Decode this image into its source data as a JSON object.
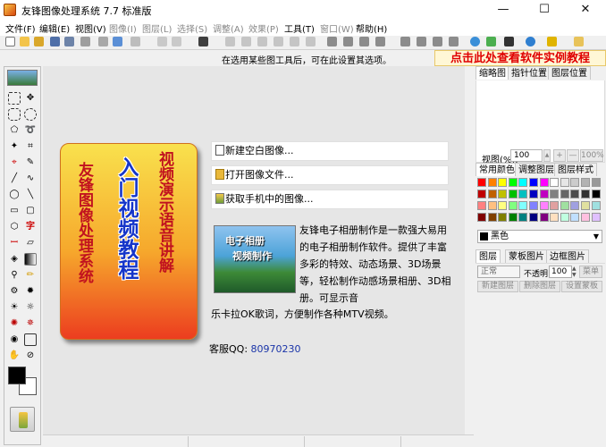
{
  "window": {
    "title": "友锋图像处理系统 7.7 标准版",
    "min": "—",
    "max": "☐",
    "close": "✕"
  },
  "menu": [
    {
      "label": "文件(F)",
      "enabled": true
    },
    {
      "label": "编辑(E)",
      "enabled": true
    },
    {
      "label": "视图(V)",
      "enabled": true
    },
    {
      "label": "图像(I)",
      "enabled": false
    },
    {
      "label": "图层(L)",
      "enabled": false
    },
    {
      "label": "选择(S)",
      "enabled": false
    },
    {
      "label": "调整(A)",
      "enabled": false
    },
    {
      "label": "效果(P)",
      "enabled": false
    },
    {
      "label": "工具(T)",
      "enabled": true
    },
    {
      "label": "窗口(W)",
      "enabled": false
    },
    {
      "label": "帮助(H)",
      "enabled": true
    }
  ],
  "hint": "在选用某些图工具后，可在此设置其选项。",
  "promo": "点击此处查看软件实例教程",
  "colors": {
    "accent_red": "#e00000",
    "link_blue": "#1a34a8"
  },
  "welcome": {
    "card": {
      "col1": "友锋图像处理系统",
      "col2": "入门视频教程",
      "col3": "视频演示语音讲解"
    },
    "actions": [
      {
        "label": "新建空白图像...",
        "icon": "new-doc-icon"
      },
      {
        "label": "打开图像文件...",
        "icon": "open-folder-icon"
      },
      {
        "label": "获取手机中的图像...",
        "icon": "phone-icon"
      }
    ],
    "image_overlay": {
      "line1": "电子相册",
      "line2": "视频制作"
    },
    "description_a": "友锋电子相册制作是一款强大易用的电子相册制作软件。提供了丰富多彩的特效、动态场景、3D场景等，轻松制作动感场景相册、3D相册。可显示音",
    "description_b": "乐卡拉OK歌词，方便制作各种MTV视频。",
    "qq_label": "客服QQ:",
    "qq_number": "80970230"
  },
  "right_panel": {
    "nav_tabs": [
      "缩略图",
      "指针位置",
      "图层位置"
    ],
    "zoom_label": "视图(%):",
    "zoom_value": "100",
    "zoom_plus": "+",
    "zoom_minus": "—",
    "zoom_full": "100%",
    "color_tabs": [
      "常用颜色",
      "调整图层",
      "图层样式"
    ],
    "selected_color": "黑色",
    "layer_tabs": [
      "图层",
      "蒙板图片",
      "边框图片"
    ],
    "blend_mode": "正常",
    "opacity_label": "不透明",
    "opacity_value": "100",
    "menu_btn": "菜单",
    "layer_buttons": [
      "新建图层",
      "删除图层",
      "设置蒙板"
    ]
  }
}
